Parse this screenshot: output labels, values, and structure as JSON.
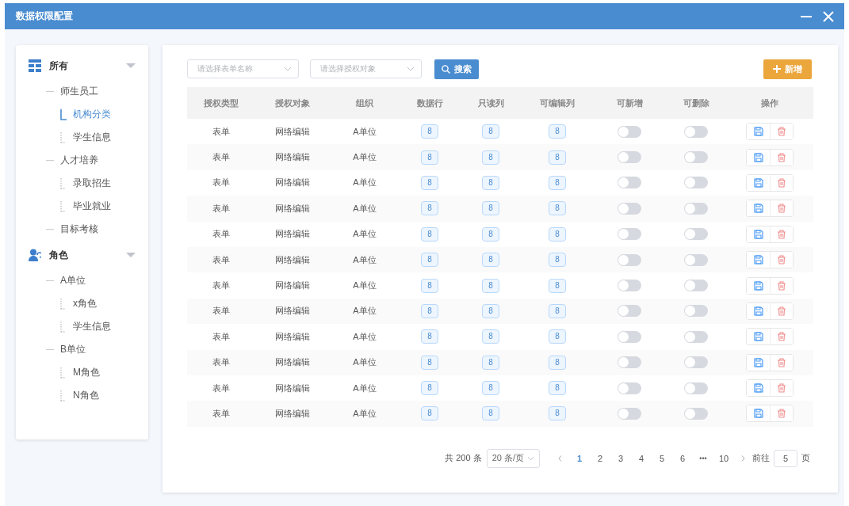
{
  "window": {
    "title": "数据权限配置"
  },
  "tree": [
    {
      "label": "所有",
      "kind": "grid",
      "expanded": true,
      "selected": false,
      "children": [
        {
          "label": "师生员工",
          "selected": false,
          "children": [
            {
              "label": "机构分类",
              "selected": true
            },
            {
              "label": "学生信息",
              "selected": false
            }
          ]
        },
        {
          "label": "人才培养",
          "selected": false,
          "children": [
            {
              "label": "录取招生",
              "selected": false
            },
            {
              "label": "毕业就业",
              "selected": false
            }
          ]
        },
        {
          "label": "目标考核",
          "selected": false
        }
      ]
    },
    {
      "label": "角色",
      "kind": "user",
      "expanded": true,
      "selected": false,
      "children": [
        {
          "label": "A单位",
          "selected": false,
          "children": [
            {
              "label": "x角色",
              "selected": false
            },
            {
              "label": "学生信息",
              "selected": false
            }
          ]
        },
        {
          "label": "B单位",
          "selected": false,
          "children": [
            {
              "label": "M角色",
              "selected": false
            },
            {
              "label": "N角色",
              "selected": false
            }
          ]
        }
      ]
    }
  ],
  "filters": [
    {
      "placeholder": "请选择表单名称"
    },
    {
      "placeholder": "请选择授权对象"
    }
  ],
  "search_button": "搜索",
  "add_button": "新增",
  "table": {
    "columns": [
      "授权类型",
      "授权对象",
      "组织",
      "数据行",
      "只读列",
      "可编辑列",
      "可新增",
      "可删除",
      "操作"
    ],
    "rows": [
      {
        "type": "表单",
        "target": "网络编辑",
        "org": "A单位",
        "data_rows": "8",
        "readonly_cols": "8",
        "editable_cols": "8",
        "can_add": false,
        "can_delete": false
      },
      {
        "type": "表单",
        "target": "网络编辑",
        "org": "A单位",
        "data_rows": "8",
        "readonly_cols": "8",
        "editable_cols": "8",
        "can_add": false,
        "can_delete": false
      },
      {
        "type": "表单",
        "target": "网络编辑",
        "org": "A单位",
        "data_rows": "8",
        "readonly_cols": "8",
        "editable_cols": "8",
        "can_add": false,
        "can_delete": false
      },
      {
        "type": "表单",
        "target": "网络编辑",
        "org": "A单位",
        "data_rows": "8",
        "readonly_cols": "8",
        "editable_cols": "8",
        "can_add": false,
        "can_delete": false
      },
      {
        "type": "表单",
        "target": "网络编辑",
        "org": "A单位",
        "data_rows": "8",
        "readonly_cols": "8",
        "editable_cols": "8",
        "can_add": false,
        "can_delete": false
      },
      {
        "type": "表单",
        "target": "网络编辑",
        "org": "A单位",
        "data_rows": "8",
        "readonly_cols": "8",
        "editable_cols": "8",
        "can_add": false,
        "can_delete": false
      },
      {
        "type": "表单",
        "target": "网络编辑",
        "org": "A单位",
        "data_rows": "8",
        "readonly_cols": "8",
        "editable_cols": "8",
        "can_add": false,
        "can_delete": false
      },
      {
        "type": "表单",
        "target": "网络编辑",
        "org": "A单位",
        "data_rows": "8",
        "readonly_cols": "8",
        "editable_cols": "8",
        "can_add": false,
        "can_delete": false
      },
      {
        "type": "表单",
        "target": "网络编辑",
        "org": "A单位",
        "data_rows": "8",
        "readonly_cols": "8",
        "editable_cols": "8",
        "can_add": false,
        "can_delete": false
      },
      {
        "type": "表单",
        "target": "网络编辑",
        "org": "A单位",
        "data_rows": "8",
        "readonly_cols": "8",
        "editable_cols": "8",
        "can_add": false,
        "can_delete": false
      },
      {
        "type": "表单",
        "target": "网络编辑",
        "org": "A单位",
        "data_rows": "8",
        "readonly_cols": "8",
        "editable_cols": "8",
        "can_add": false,
        "can_delete": false
      },
      {
        "type": "表单",
        "target": "网络编辑",
        "org": "A单位",
        "data_rows": "8",
        "readonly_cols": "8",
        "editable_cols": "8",
        "can_add": false,
        "can_delete": false
      }
    ]
  },
  "pagination": {
    "total": "共 200 条",
    "page_size": "20 条/页",
    "pages": [
      {
        "label": "1",
        "selected": true
      },
      {
        "label": "2",
        "selected": false
      },
      {
        "label": "3",
        "selected": false
      },
      {
        "label": "4",
        "selected": false
      },
      {
        "label": "5",
        "selected": false
      },
      {
        "label": "6",
        "selected": false
      },
      {
        "label": "•••",
        "kind": "more",
        "selected": false
      },
      {
        "label": "10",
        "selected": false
      }
    ],
    "goto_label": "前往",
    "goto_value": "5",
    "goto_unit": "页"
  }
}
